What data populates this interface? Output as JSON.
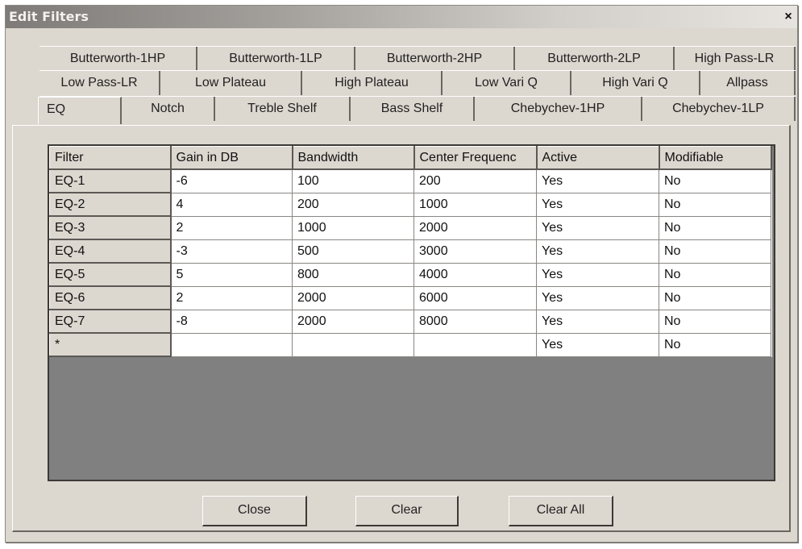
{
  "window": {
    "title": "Edit Filters",
    "close_glyph": "×"
  },
  "tabs": {
    "row1": [
      "Butterworth-1HP",
      "Butterworth-1LP",
      "Butterworth-2HP",
      "Butterworth-2LP",
      "High Pass-LR"
    ],
    "row2": [
      "Low Pass-LR",
      "Low Plateau",
      "High Plateau",
      "Low Vari Q",
      "High Vari Q",
      "Allpass"
    ],
    "row3": [
      "EQ",
      "Notch",
      "Treble Shelf",
      "Bass Shelf",
      "Chebychev-1HP",
      "Chebychev-1LP"
    ],
    "selected": "EQ"
  },
  "table": {
    "headers": [
      "Filter",
      "Gain in DB",
      "Bandwidth",
      "Center Frequenc",
      "Active",
      "Modifiable"
    ],
    "rows": [
      [
        "EQ-1",
        "-6",
        "100",
        "200",
        "Yes",
        "No"
      ],
      [
        "EQ-2",
        "4",
        "200",
        "1000",
        "Yes",
        "No"
      ],
      [
        "EQ-3",
        "2",
        "1000",
        "2000",
        "Yes",
        "No"
      ],
      [
        "EQ-4",
        "-3",
        "500",
        "3000",
        "Yes",
        "No"
      ],
      [
        "EQ-5",
        "5",
        "800",
        "4000",
        "Yes",
        "No"
      ],
      [
        "EQ-6",
        "2",
        "2000",
        "6000",
        "Yes",
        "No"
      ],
      [
        "EQ-7",
        "-8",
        "2000",
        "8000",
        "Yes",
        "No"
      ],
      [
        "*",
        "",
        "",
        "",
        "Yes",
        "No"
      ]
    ]
  },
  "buttons": {
    "close": "Close",
    "clear": "Clear",
    "clear_all": "Clear All"
  }
}
